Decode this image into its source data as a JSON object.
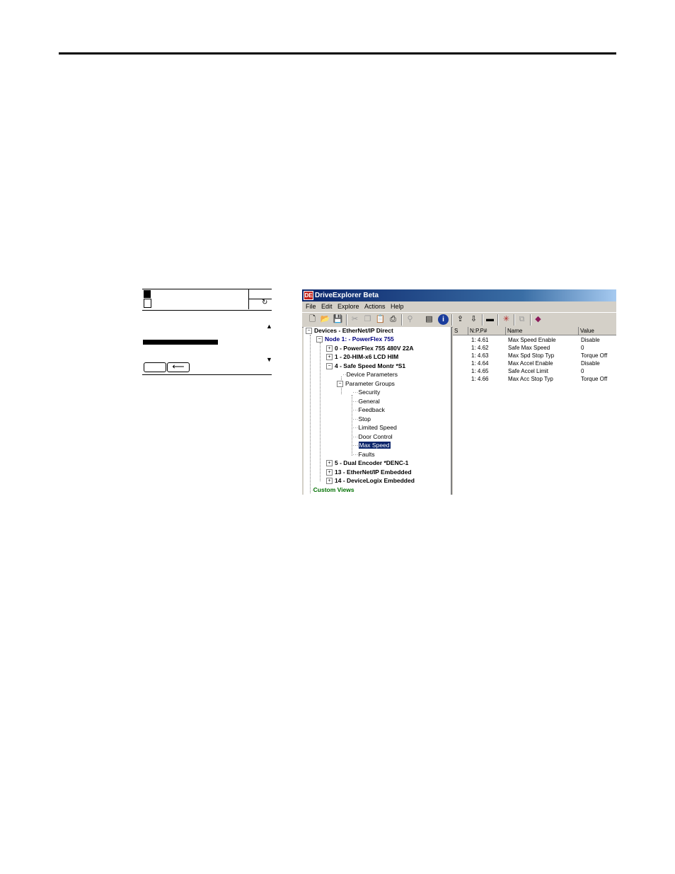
{
  "him": {
    "refresh_symbol": "↻",
    "up_arrow": "▲",
    "down_arrow": "▼",
    "back_symbol": "⟵"
  },
  "window": {
    "title": "DriveExplorer Beta",
    "app_icon": "DE",
    "menu": [
      "File",
      "Edit",
      "Explore",
      "Actions",
      "Help"
    ],
    "toolbar_icons": [
      "new-file-icon",
      "open-folder-icon",
      "save-icon",
      "cut-icon",
      "copy-icon",
      "paste-icon",
      "print-icon",
      "disconnect-icon",
      "properties-icon",
      "info-icon",
      "upload-icon",
      "download-icon",
      "monitor-icon",
      "wizard-icon",
      "compare-icon",
      "help-book-icon"
    ]
  },
  "tree": {
    "root": "Devices - EtherNet/IP Direct",
    "node": "Node 1: - PowerFlex 755",
    "ports": [
      {
        "num": "0",
        "label": "- PowerFlex 755 480V  22A"
      },
      {
        "num": "1",
        "label": "- 20-HIM-x6 LCD HIM"
      },
      {
        "num": "4",
        "label": "- Safe Speed Montr *S1"
      }
    ],
    "device_parameters": "Device Parameters",
    "parameter_groups": "Parameter Groups",
    "groups": [
      "Security",
      "General",
      "Feedback",
      "Stop",
      "Limited Speed",
      "Door Control",
      "Max Speed",
      "Faults"
    ],
    "selected_group": "Max Speed",
    "more_ports": [
      {
        "num": "5",
        "label": "- Dual Encoder *DENC-1"
      },
      {
        "num": "13",
        "label": "- EtherNet/IP Embedded"
      },
      {
        "num": "14",
        "label": "- DeviceLogix Embedded"
      }
    ],
    "custom_views": "Custom Views"
  },
  "list": {
    "columns": [
      "S",
      "N:P.P#",
      "Name",
      "Value"
    ],
    "rows": [
      {
        "s": "",
        "num": "1: 4.61",
        "name": "Max Speed Enable",
        "value": "Disable"
      },
      {
        "s": "",
        "num": "1: 4.62",
        "name": "Safe Max Speed",
        "value": "0"
      },
      {
        "s": "",
        "num": "1: 4.63",
        "name": "Max Spd Stop Typ",
        "value": "Torque Off"
      },
      {
        "s": "",
        "num": "1: 4.64",
        "name": "Max Accel Enable",
        "value": "Disable"
      },
      {
        "s": "",
        "num": "1: 4.65",
        "name": "Safe Accel Limit",
        "value": "0"
      },
      {
        "s": "",
        "num": "1: 4.66",
        "name": "Max Acc Stop Typ",
        "value": "Torque Off"
      }
    ]
  }
}
